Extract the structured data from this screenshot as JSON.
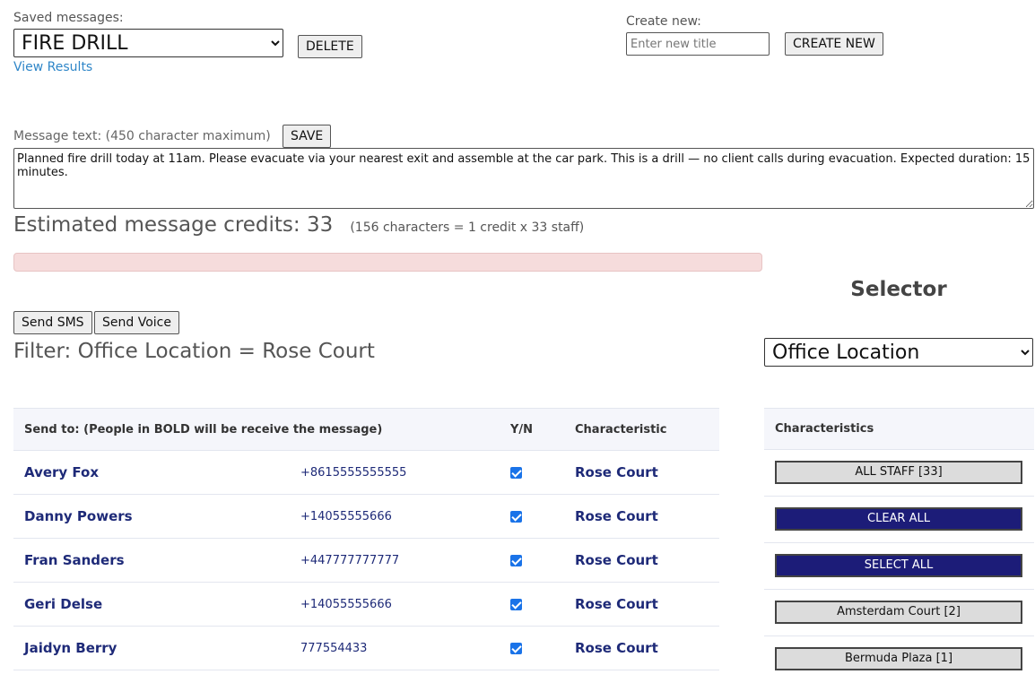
{
  "saved": {
    "label": "Saved messages:",
    "selected": "FIRE DRILL",
    "delete_label": "DELETE",
    "view_results": "View Results"
  },
  "create": {
    "label": "Create new:",
    "placeholder": "Enter new title",
    "button_label": "CREATE NEW"
  },
  "message": {
    "label": "Message text: (450 character maximum)",
    "save_label": "SAVE",
    "text": "Planned fire drill today at 11am. Please evacuate via your nearest exit and assemble at the car park. This is a drill — no client calls during evacuation. Expected duration: 15 minutes."
  },
  "credits": {
    "estimate": "Estimated message credits: 33",
    "detail": "(156 characters = 1 credit x 33 staff)",
    "progress_fraction": 0.0
  },
  "selector": {
    "heading": "Selector",
    "selected": "Office Location"
  },
  "actions": {
    "send_sms": "Send SMS",
    "send_voice": "Send Voice"
  },
  "filter": {
    "text": "Filter: Office Location = Rose Court"
  },
  "table": {
    "headers": {
      "send_to": "Send to: (People in BOLD will be receive the message)",
      "yn": "Y/N",
      "characteristic": "Characteristic"
    },
    "rows": [
      {
        "name": "Avery Fox",
        "phone": "+8615555555555",
        "checked": true,
        "characteristic": "Rose Court"
      },
      {
        "name": "Danny Powers",
        "phone": "+14055555666",
        "checked": true,
        "characteristic": "Rose Court"
      },
      {
        "name": "Fran Sanders",
        "phone": "+447777777777",
        "checked": true,
        "characteristic": "Rose Court"
      },
      {
        "name": "Geri Delse",
        "phone": "+14055555666",
        "checked": true,
        "characteristic": "Rose Court"
      },
      {
        "name": "Jaidyn Berry",
        "phone": "777554433",
        "checked": true,
        "characteristic": "Rose Court"
      }
    ]
  },
  "characteristics": {
    "header": "Characteristics",
    "buttons": [
      {
        "label": "ALL STAFF  [33]",
        "style": "light"
      },
      {
        "label": "CLEAR ALL",
        "style": "dark"
      },
      {
        "label": "SELECT ALL",
        "style": "dark"
      },
      {
        "label": "Amsterdam Court  [2]",
        "style": "light"
      },
      {
        "label": "Bermuda Plaza  [1]",
        "style": "light"
      }
    ]
  },
  "colors": {
    "link": "#2f86c8",
    "name_text": "#1e2a78",
    "dark_button": "#1c1c78",
    "checkbox": "#1a73e8",
    "progress_bg": "#f6dcdc"
  }
}
